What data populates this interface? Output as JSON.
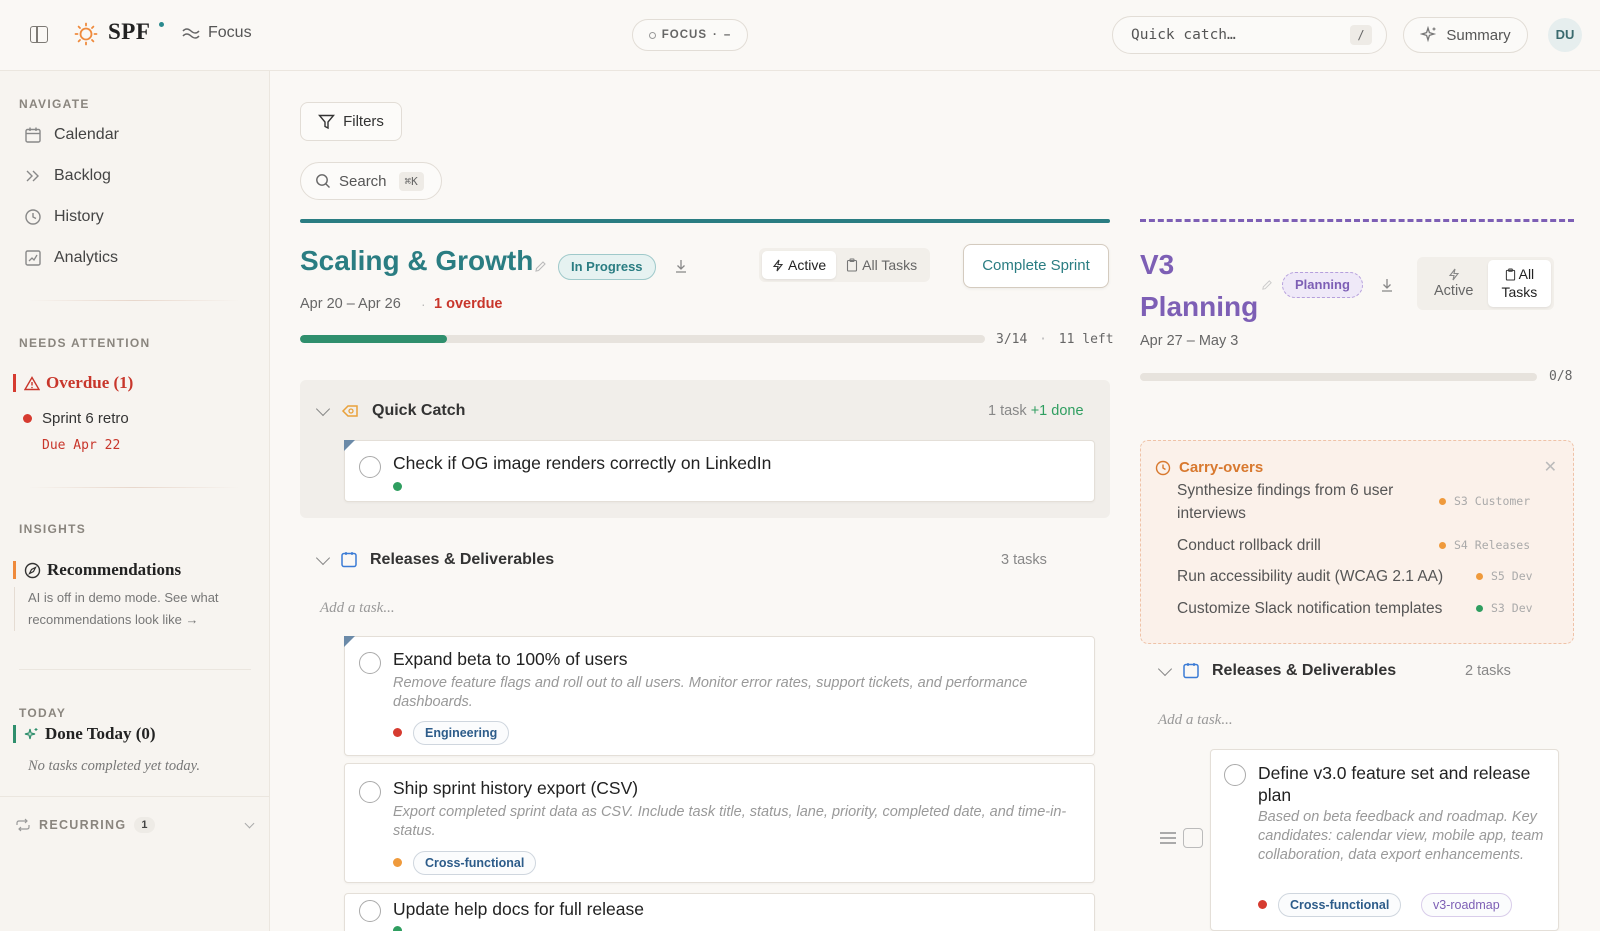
{
  "header": {
    "brand": "SPF",
    "focus_link": "Focus",
    "focus_pill": "FOCUS",
    "focus_pill_sep": "·",
    "focus_pill_dash": "–",
    "quick_catch_placeholder": "Quick catch…",
    "quick_catch_key": "/",
    "summary_label": "Summary",
    "avatar_initials": "DU"
  },
  "sidebar": {
    "navigate_title": "NAVIGATE",
    "nav": [
      {
        "label": "Calendar",
        "icon": "calendar-icon"
      },
      {
        "label": "Backlog",
        "icon": "double-chevron-icon"
      },
      {
        "label": "History",
        "icon": "clock-icon"
      },
      {
        "label": "Analytics",
        "icon": "analytics-icon"
      }
    ],
    "attention_title": "NEEDS ATTENTION",
    "overdue_label": "Overdue (1)",
    "overdue_item": "Sprint 6 retro",
    "overdue_due": "Due Apr 22",
    "insights_title": "INSIGHTS",
    "recommendations_label": "Recommendations",
    "recommendations_text": "AI is off in demo mode. See what recommendations look like →",
    "today_title": "TODAY",
    "done_today_label": "Done Today (0)",
    "done_today_empty": "No tasks completed yet today.",
    "recurring_label": "RECURRING",
    "recurring_count": "1"
  },
  "toolbar": {
    "filters_label": "Filters",
    "search_label": "Search",
    "search_key": "⌘K"
  },
  "sprint_current": {
    "title": "Scaling & Growth",
    "status": "In Progress",
    "view_active": "Active",
    "view_all": "All Tasks",
    "complete_label": "Complete Sprint",
    "dates": "Apr 20 – Apr 26",
    "overdue": "1 overdue",
    "progress_done": 3,
    "progress_total": 14,
    "progress_text": "3/14",
    "progress_left": "11 left",
    "lanes": {
      "quick_catch": {
        "title": "Quick Catch",
        "meta": "1 task",
        "meta_done": "+1 done",
        "card_title": "Check if OG image renders correctly on LinkedIn"
      },
      "releases": {
        "title": "Releases & Deliverables",
        "meta": "3 tasks",
        "add_placeholder": "Add a task...",
        "cards": [
          {
            "title": "Expand beta to 100% of users",
            "desc": "Remove feature flags and roll out to all users. Monitor error rates, support tickets, and performance dashboards.",
            "tag": "Engineering",
            "priority_color": "#d63b30"
          },
          {
            "title": "Ship sprint history export (CSV)",
            "desc": "Export completed sprint data as CSV. Include task title, status, lane, priority, completed date, and time-in-status.",
            "tag": "Cross-functional",
            "priority_color": "#ef9a3c"
          },
          {
            "title": "Update help docs for full release"
          }
        ]
      }
    }
  },
  "sprint_next": {
    "title": "V3 Planning",
    "title_line1": "V3",
    "title_line2": "Planning",
    "status": "Planning",
    "view_active": "Active",
    "view_all_line1": "All",
    "view_all_line2": "Tasks",
    "dates": "Apr 27 – May 3",
    "progress_done": 0,
    "progress_total": 8,
    "progress_text": "0/8",
    "carry_title": "Carry-overs",
    "carry_items": [
      {
        "text": "Synthesize findings from 6 user interviews",
        "ref": "S3 Customer",
        "color": "#ef9a3c"
      },
      {
        "text": "Conduct rollback drill",
        "ref": "S4 Releases",
        "color": "#ef9a3c"
      },
      {
        "text": "Run accessibility audit (WCAG 2.1 AA)",
        "ref": "S5 Dev",
        "color": "#ef9a3c"
      },
      {
        "text": "Customize Slack notification templates",
        "ref": "S3 Dev",
        "color": "#2f9e60"
      }
    ],
    "lane_title": "Releases & Deliverables",
    "lane_meta": "2 tasks",
    "add_placeholder": "Add a task...",
    "card_title": "Define v3.0 feature set and release plan",
    "card_desc": "Based on beta feedback and roadmap. Key candidates: calendar view, mobile app, team collaboration, data export enhancements.",
    "card_tags": [
      "Cross-functional",
      "v3-roadmap"
    ],
    "card_priority_color": "#d63b30"
  },
  "colors": {
    "teal": "#2a7d82",
    "purple": "#7d5fb5",
    "overdue_red": "#c8362b",
    "carry_orange": "#d8792f",
    "progress_green": "#2f8f6d"
  }
}
